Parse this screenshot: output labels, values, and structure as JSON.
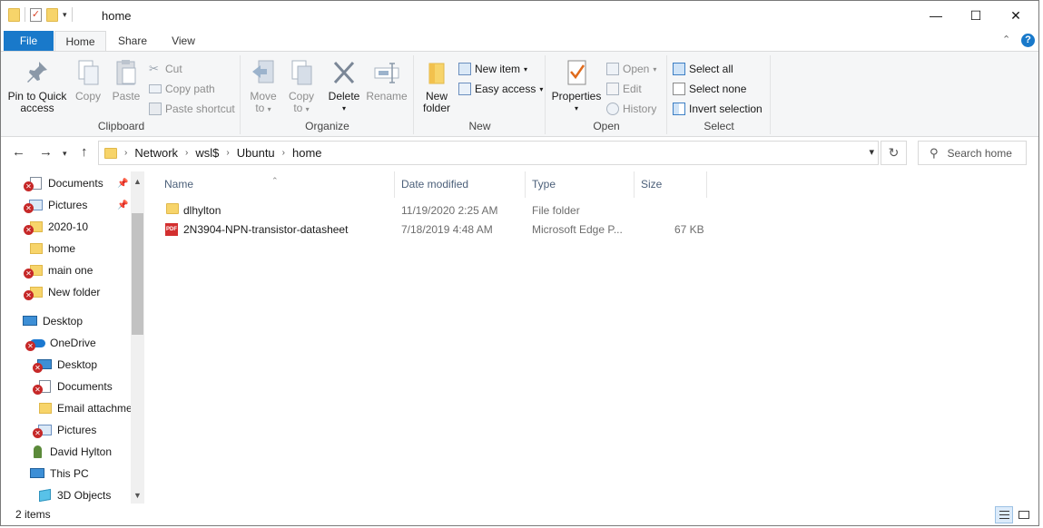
{
  "window": {
    "title": "home",
    "controls": {
      "minimize": "—",
      "maximize": "☐",
      "close": "✕"
    }
  },
  "ribbon_tabs": [
    "File",
    "Home",
    "Share",
    "View"
  ],
  "ribbon": {
    "clipboard": {
      "label": "Clipboard",
      "pin": "Pin to Quick access",
      "pin_line1": "Pin to Quick",
      "pin_line2": "access",
      "copy": "Copy",
      "paste": "Paste",
      "cut": "Cut",
      "copy_path": "Copy path",
      "paste_shortcut": "Paste shortcut"
    },
    "organize": {
      "label": "Organize",
      "move_to": "Move",
      "copy_to": "Copy",
      "to": "to",
      "delete": "Delete",
      "rename": "Rename"
    },
    "new": {
      "label": "New",
      "new_folder_line1": "New",
      "new_folder_line2": "folder",
      "new_item": "New item",
      "easy_access": "Easy access"
    },
    "open": {
      "label": "Open",
      "properties": "Properties",
      "open": "Open",
      "edit": "Edit",
      "history": "History"
    },
    "select": {
      "label": "Select",
      "select_all": "Select all",
      "select_none": "Select none",
      "invert": "Invert selection"
    }
  },
  "address": {
    "breadcrumbs": [
      "Network",
      "wsl$",
      "Ubuntu",
      "home"
    ],
    "search_placeholder": "Search home"
  },
  "nav_pane": {
    "items": [
      {
        "label": "Documents",
        "icon": "documents-icon",
        "error": true,
        "pinned": true
      },
      {
        "label": "Pictures",
        "icon": "pictures-icon",
        "error": true,
        "pinned": true
      },
      {
        "label": "2020-10",
        "icon": "folder-icon",
        "error": true,
        "pinned": false
      },
      {
        "label": "home",
        "icon": "folder-icon",
        "error": false,
        "pinned": false
      },
      {
        "label": "main one",
        "icon": "folder-icon",
        "error": true,
        "pinned": false
      },
      {
        "label": "New folder",
        "icon": "folder-icon",
        "error": true,
        "pinned": false
      },
      {
        "label": "Desktop",
        "icon": "desktop-icon",
        "error": false,
        "pinned": false
      },
      {
        "label": "OneDrive",
        "icon": "onedrive-icon",
        "error": true,
        "pinned": false
      },
      {
        "label": "Desktop",
        "icon": "desktop-icon",
        "error": true,
        "pinned": false
      },
      {
        "label": "Documents",
        "icon": "documents-icon",
        "error": true,
        "pinned": false
      },
      {
        "label": "Email attachme",
        "icon": "folder-icon",
        "error": false,
        "pinned": false
      },
      {
        "label": "Pictures",
        "icon": "pictures-icon",
        "error": true,
        "pinned": false
      },
      {
        "label": "David Hylton",
        "icon": "user-icon",
        "error": false,
        "pinned": false
      },
      {
        "label": "This PC",
        "icon": "computer-icon",
        "error": false,
        "pinned": false
      },
      {
        "label": "3D Objects",
        "icon": "3d-objects-icon",
        "error": false,
        "pinned": false
      }
    ]
  },
  "file_list": {
    "columns": [
      "Name",
      "Date modified",
      "Type",
      "Size"
    ],
    "rows": [
      {
        "name": "dlhylton",
        "date": "11/19/2020 2:25 AM",
        "type": "File folder",
        "size": "",
        "icon": "folder-icon"
      },
      {
        "name": "2N3904-NPN-transistor-datasheet",
        "date": "7/18/2019 4:48 AM",
        "type": "Microsoft Edge P...",
        "size": "67 KB",
        "icon": "pdf-icon"
      }
    ]
  },
  "status_bar": {
    "item_count": "2 items"
  },
  "colors": {
    "accent": "#1979ca",
    "ribbon_bg": "#f5f6f7",
    "folder": "#f7d46a",
    "error": "#c62828"
  }
}
